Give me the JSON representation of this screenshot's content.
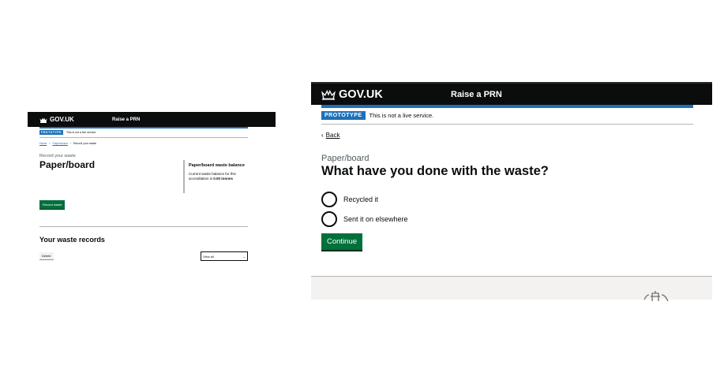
{
  "left": {
    "header": {
      "logo_text": "GOV.UK",
      "service_name": "Raise a PRN"
    },
    "phase_banner": {
      "tag": "PROTOTYPE",
      "text": "This is not a live service."
    },
    "breadcrumbs": [
      "Home",
      "Paper/board",
      "Record your waste"
    ],
    "caption": "Record your waste",
    "title": "Paper/board",
    "aside": {
      "heading": "Paper/board waste balance",
      "text_prefix": "Current waste balance for this accreditation is",
      "amount": "0.00 tonnes"
    },
    "record_button": "Record waste",
    "records_heading": "Your waste records",
    "delete_button": "Delete",
    "view_select": "View all"
  },
  "right": {
    "header": {
      "logo_text": "GOV.UK",
      "service_name": "Raise a PRN"
    },
    "phase_banner": {
      "tag": "PROTOTYPE",
      "text": "This is not a live service."
    },
    "back_link": "Back",
    "caption": "Paper/board",
    "question": "What have you done with the waste?",
    "options": [
      "Recycled it",
      "Sent it on elsewhere"
    ],
    "continue_button": "Continue"
  }
}
